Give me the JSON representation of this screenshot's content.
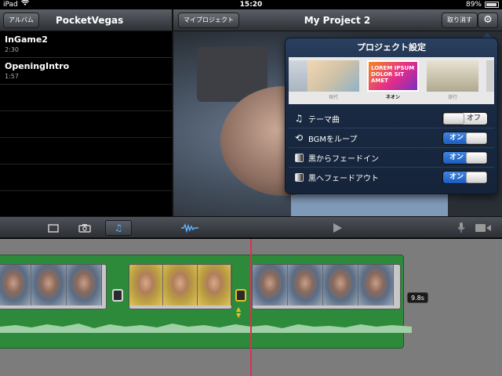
{
  "status_bar": {
    "carrier": "iPad",
    "wifi_icon": "wifi-icon",
    "time": "15:20",
    "battery_percent": "89%",
    "battery_level": 0.89
  },
  "toolbar": {
    "album_button": "アルバム",
    "library_title": "PocketVegas",
    "my_projects_button": "マイプロジェクト",
    "project_title": "My Project 2",
    "undo_button": "取り消す",
    "settings_icon": "gear-icon"
  },
  "clips": [
    {
      "name": "InGame2",
      "duration": "2:30"
    },
    {
      "name": "OpeningIntro",
      "duration": "1:57"
    }
  ],
  "settings": {
    "title": "プロジェクト設定",
    "themes": [
      {
        "label": "現代"
      },
      {
        "label": "ネオン",
        "selected": true,
        "preview_text": "LOREM IPSUM DOLOR SIT AMET"
      },
      {
        "label": "旅行"
      }
    ],
    "rows": [
      {
        "icon": "music-note-icon",
        "label": "テーマ曲",
        "state": "off",
        "state_label": "オフ"
      },
      {
        "icon": "loop-icon",
        "label": "BGMをループ",
        "state": "on",
        "state_label": "オン"
      },
      {
        "icon": "fade-from-black-icon",
        "label": "黒からフェードイン",
        "state": "on",
        "state_label": "オン"
      },
      {
        "icon": "fade-to-black-icon",
        "label": "黒へフェードアウト",
        "state": "on",
        "state_label": "オン"
      }
    ]
  },
  "controls": {
    "left": [
      {
        "icon": "video-icon",
        "selected": false
      },
      {
        "icon": "camera-icon",
        "selected": false
      },
      {
        "icon": "music-note-icon",
        "selected": true
      }
    ],
    "right": [
      "waveform-icon",
      "play-icon",
      "microphone-icon",
      "video-camera-icon"
    ]
  },
  "timeline": {
    "project_duration": "9.8s",
    "colors": {
      "track": "#2d8a3a",
      "playhead": "#e22c52",
      "transition": "#e5c227"
    }
  }
}
